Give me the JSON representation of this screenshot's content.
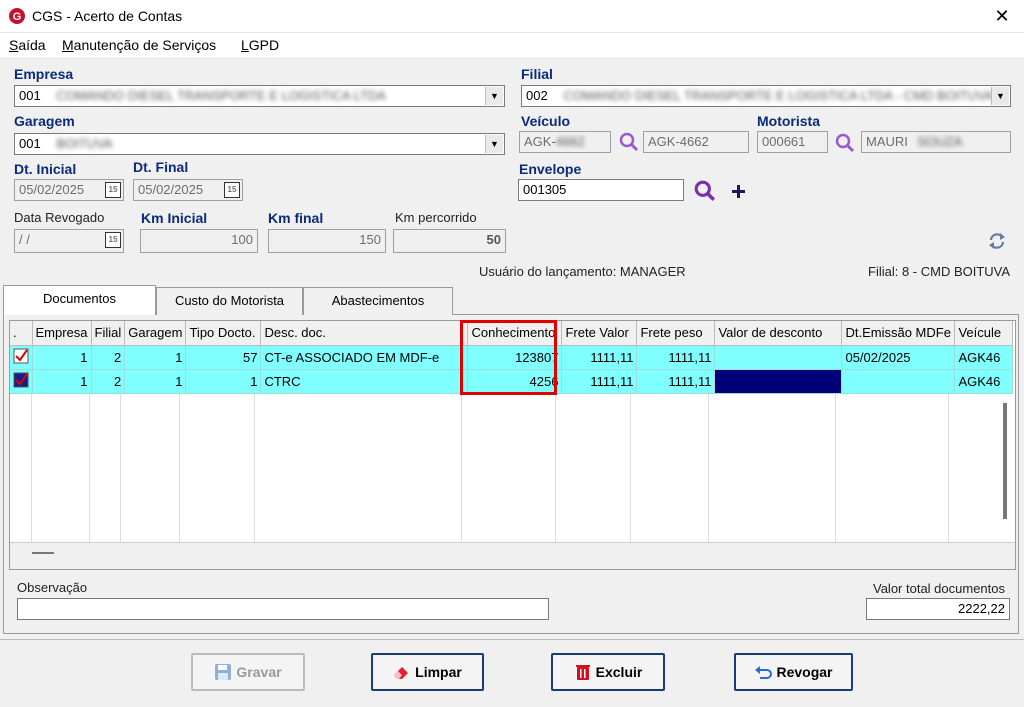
{
  "window": {
    "title": "CGS - Acerto de Contas",
    "close_glyph": "✕"
  },
  "menu": [
    "Saída",
    "Manutenção de Serviços",
    "LGPD"
  ],
  "form": {
    "empresa": {
      "label": "Empresa",
      "value": "001",
      "blurred_text": "COMANDO DIESEL TRANSPORTE E LOGISTICA LTDA"
    },
    "filial": {
      "label": "Filial",
      "value": "002",
      "blurred_text": "COMANDO DIESEL TRANSPORTE E LOGISTICA LTDA - CMD BOITUVA"
    },
    "garagem": {
      "label": "Garagem",
      "value": "001",
      "blurred_text": "BOITUVA"
    },
    "veiculo": {
      "label": "Veículo",
      "value": "AGK-",
      "blurred_suffix": "4662",
      "desc": "AGK-4662"
    },
    "motorista": {
      "label": "Motorista",
      "value": "000661",
      "name": "MAURI",
      "blurred_suffix": "SOUZA"
    },
    "dt_inicial": {
      "label": "Dt. Inicial",
      "value": "05/02/2025"
    },
    "dt_final": {
      "label": "Dt. Final",
      "value": "05/02/2025"
    },
    "envelope": {
      "label": "Envelope",
      "value": "001305"
    },
    "data_revogado": {
      "label": "Data Revogado",
      "value": " /  /"
    },
    "km_inicial": {
      "label": "Km Inicial",
      "value": "100"
    },
    "km_final": {
      "label": "Km final",
      "value": "150"
    },
    "km_percorrido": {
      "label": "Km percorrido",
      "value": "50"
    },
    "usuario": "Usuário do lançamento: MANAGER",
    "filial_info": "Filial: 8 - CMD BOITUVA",
    "cal_icon_text": "15"
  },
  "tabs": [
    "Documentos",
    "Custo do Motorista",
    "Abastecimentos"
  ],
  "grid": {
    "columns": [
      ".",
      "Empresa",
      "Filial",
      "Garagem",
      "Tipo Docto.",
      "Desc. doc.",
      "Conhecimento",
      "Frete Valor",
      "Frete peso",
      "Valor de desconto",
      "Dt.Emissão MDFe",
      "Veícule"
    ],
    "rows": [
      [
        "",
        "1",
        "2",
        "1",
        "57",
        "CT-e ASSOCIADO EM MDF-e",
        "123807",
        "1111,11",
        "1111,11",
        "",
        "05/02/2025",
        "AGK46"
      ],
      [
        "",
        "1",
        "2",
        "1",
        "1",
        "CTRC",
        "4256",
        "1111,11",
        "1111,11",
        "",
        "",
        "AGK46"
      ]
    ],
    "highlight_color": "#e00000"
  },
  "observacao": {
    "label": "Observação",
    "value": ""
  },
  "valor_total": {
    "label": "Valor total documentos",
    "value": "2222,22"
  },
  "buttons": {
    "gravar": "Gravar",
    "limpar": "Limpar",
    "excluir": "Excluir",
    "revogar": "Revogar"
  }
}
